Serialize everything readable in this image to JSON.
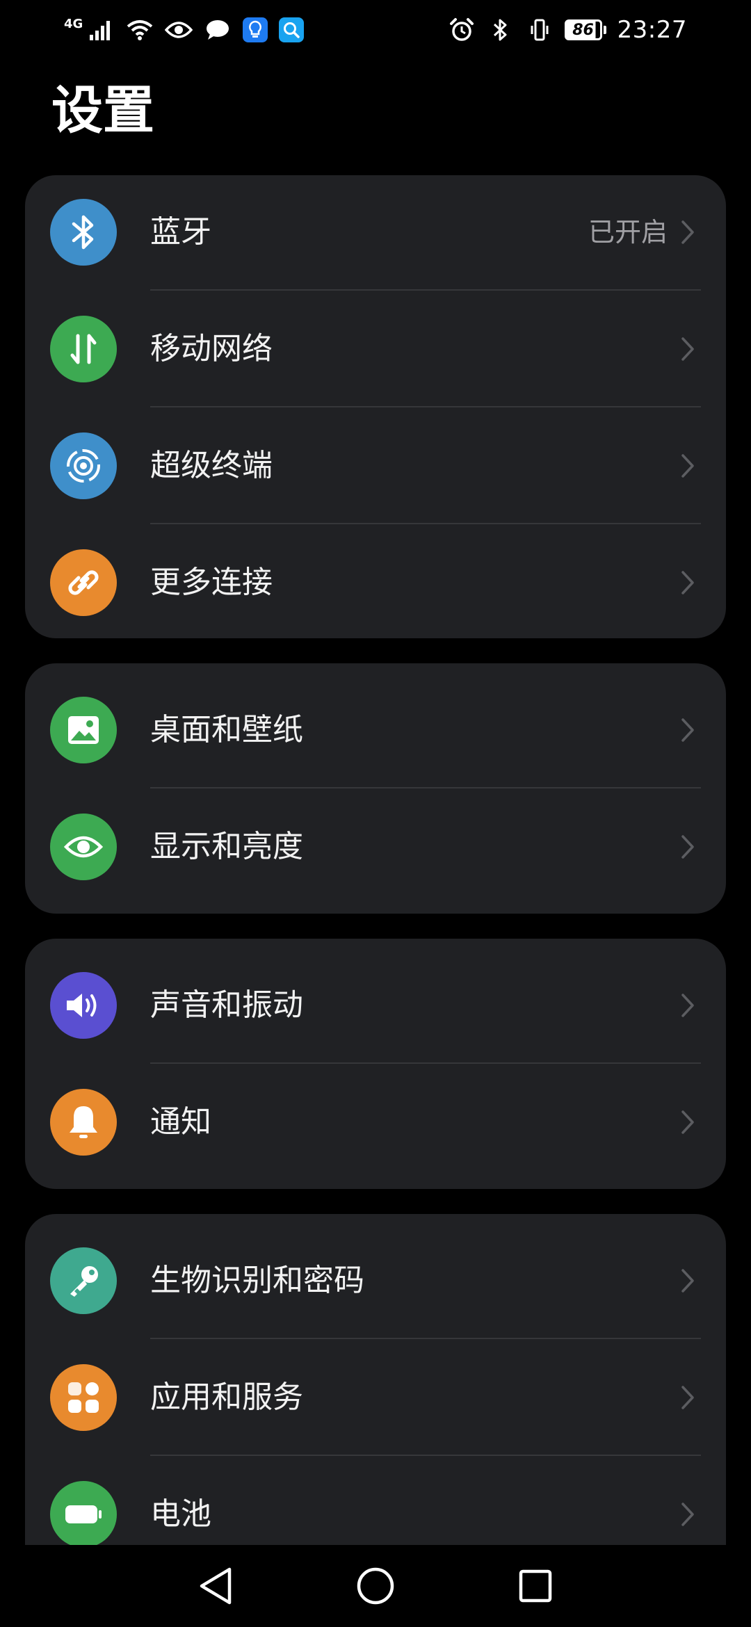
{
  "status_bar": {
    "network_label": "4G",
    "battery_level": "86",
    "battery_fraction": 0.86,
    "time": "23:27"
  },
  "page": {
    "title": "设置"
  },
  "groups": [
    {
      "items": [
        {
          "label": "蓝牙",
          "value": "已开启",
          "icon": "bluetooth-icon",
          "color": "#3f8fca"
        },
        {
          "label": "移动网络",
          "icon": "mobile-data-icon",
          "color": "#3daa52"
        },
        {
          "label": "超级终端",
          "icon": "super-device-icon",
          "color": "#3f8fca"
        },
        {
          "label": "更多连接",
          "icon": "link-icon",
          "color": "#e88a2e"
        }
      ]
    },
    {
      "items": [
        {
          "label": "桌面和壁纸",
          "icon": "wallpaper-icon",
          "color": "#3daa52"
        },
        {
          "label": "显示和亮度",
          "icon": "eye-icon",
          "color": "#3daa52"
        }
      ]
    },
    {
      "items": [
        {
          "label": "声音和振动",
          "icon": "speaker-icon",
          "color": "#5a4fd1"
        },
        {
          "label": "通知",
          "icon": "bell-icon",
          "color": "#e88a2e"
        }
      ]
    },
    {
      "items": [
        {
          "label": "生物识别和密码",
          "icon": "key-icon",
          "color": "#3fa98f"
        },
        {
          "label": "应用和服务",
          "icon": "apps-icon",
          "color": "#e88a2e"
        },
        {
          "label": "电池",
          "icon": "battery-icon",
          "color": "#3daa52"
        }
      ]
    }
  ],
  "colors": {
    "background": "#000000",
    "card": "#202124",
    "divider": "#36373a",
    "value_text": "#a0a0a4"
  }
}
